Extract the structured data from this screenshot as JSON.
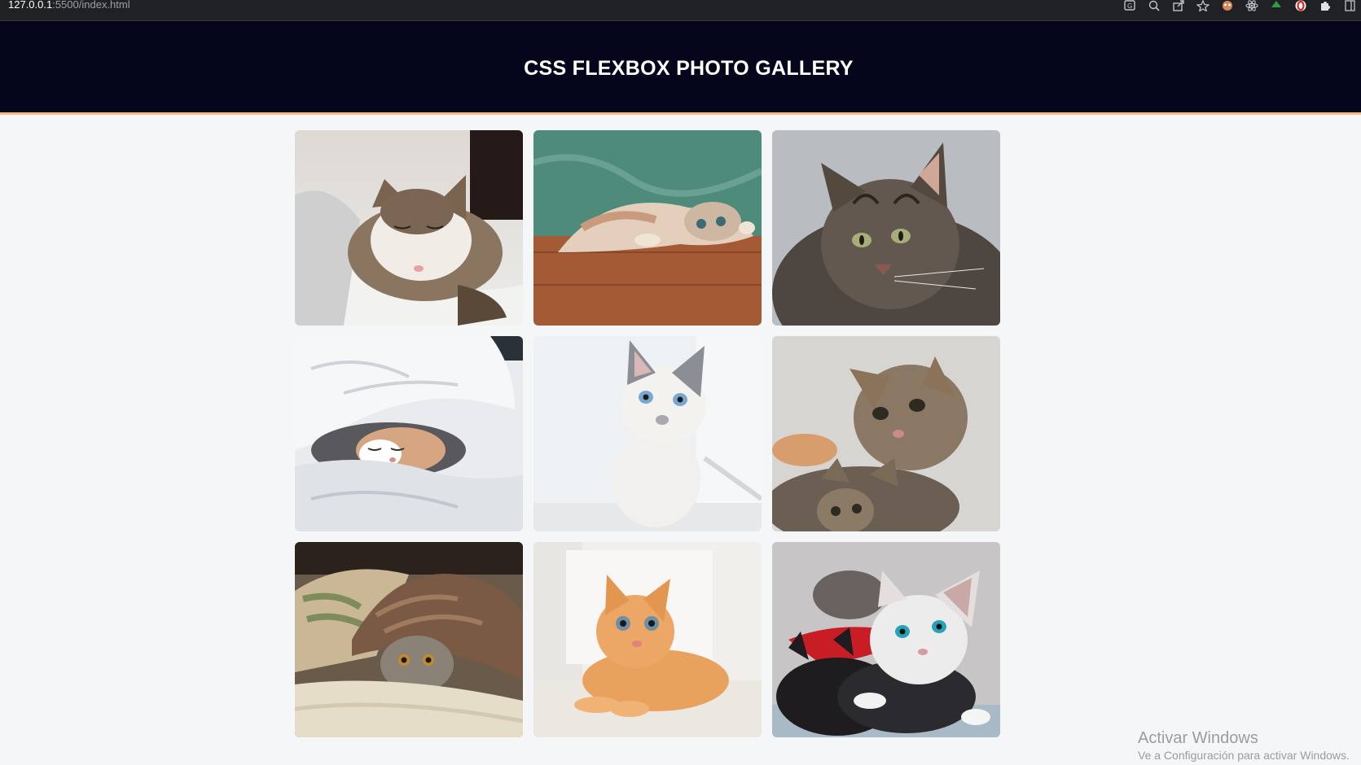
{
  "browser": {
    "url_host": "127.0.0.1",
    "url_rest": ":5500/index.html"
  },
  "header": {
    "title": "CSS FLEXBOX PHOTO GALLERY",
    "background": "#05061c",
    "accent_border": "#f2b880"
  },
  "gallery": {
    "photos": [
      {
        "subject": "sleeping tabby-white cat in blanket"
      },
      {
        "subject": "cream kitten lying upside down on wooden floor"
      },
      {
        "subject": "long-haired tabby cat portrait"
      },
      {
        "subject": "calico cat peeking from under white duvet"
      },
      {
        "subject": "white siamese kitten with blue eyes"
      },
      {
        "subject": "tabby kittens with green eyes"
      },
      {
        "subject": "grey tabby cat under brown fluffy blanket"
      },
      {
        "subject": "orange kitten lying down"
      },
      {
        "subject": "white and black kittens on red blanket"
      }
    ]
  },
  "watermark": {
    "title": "Activar Windows",
    "subtitle": "Ve a Configuración para activar Windows."
  }
}
